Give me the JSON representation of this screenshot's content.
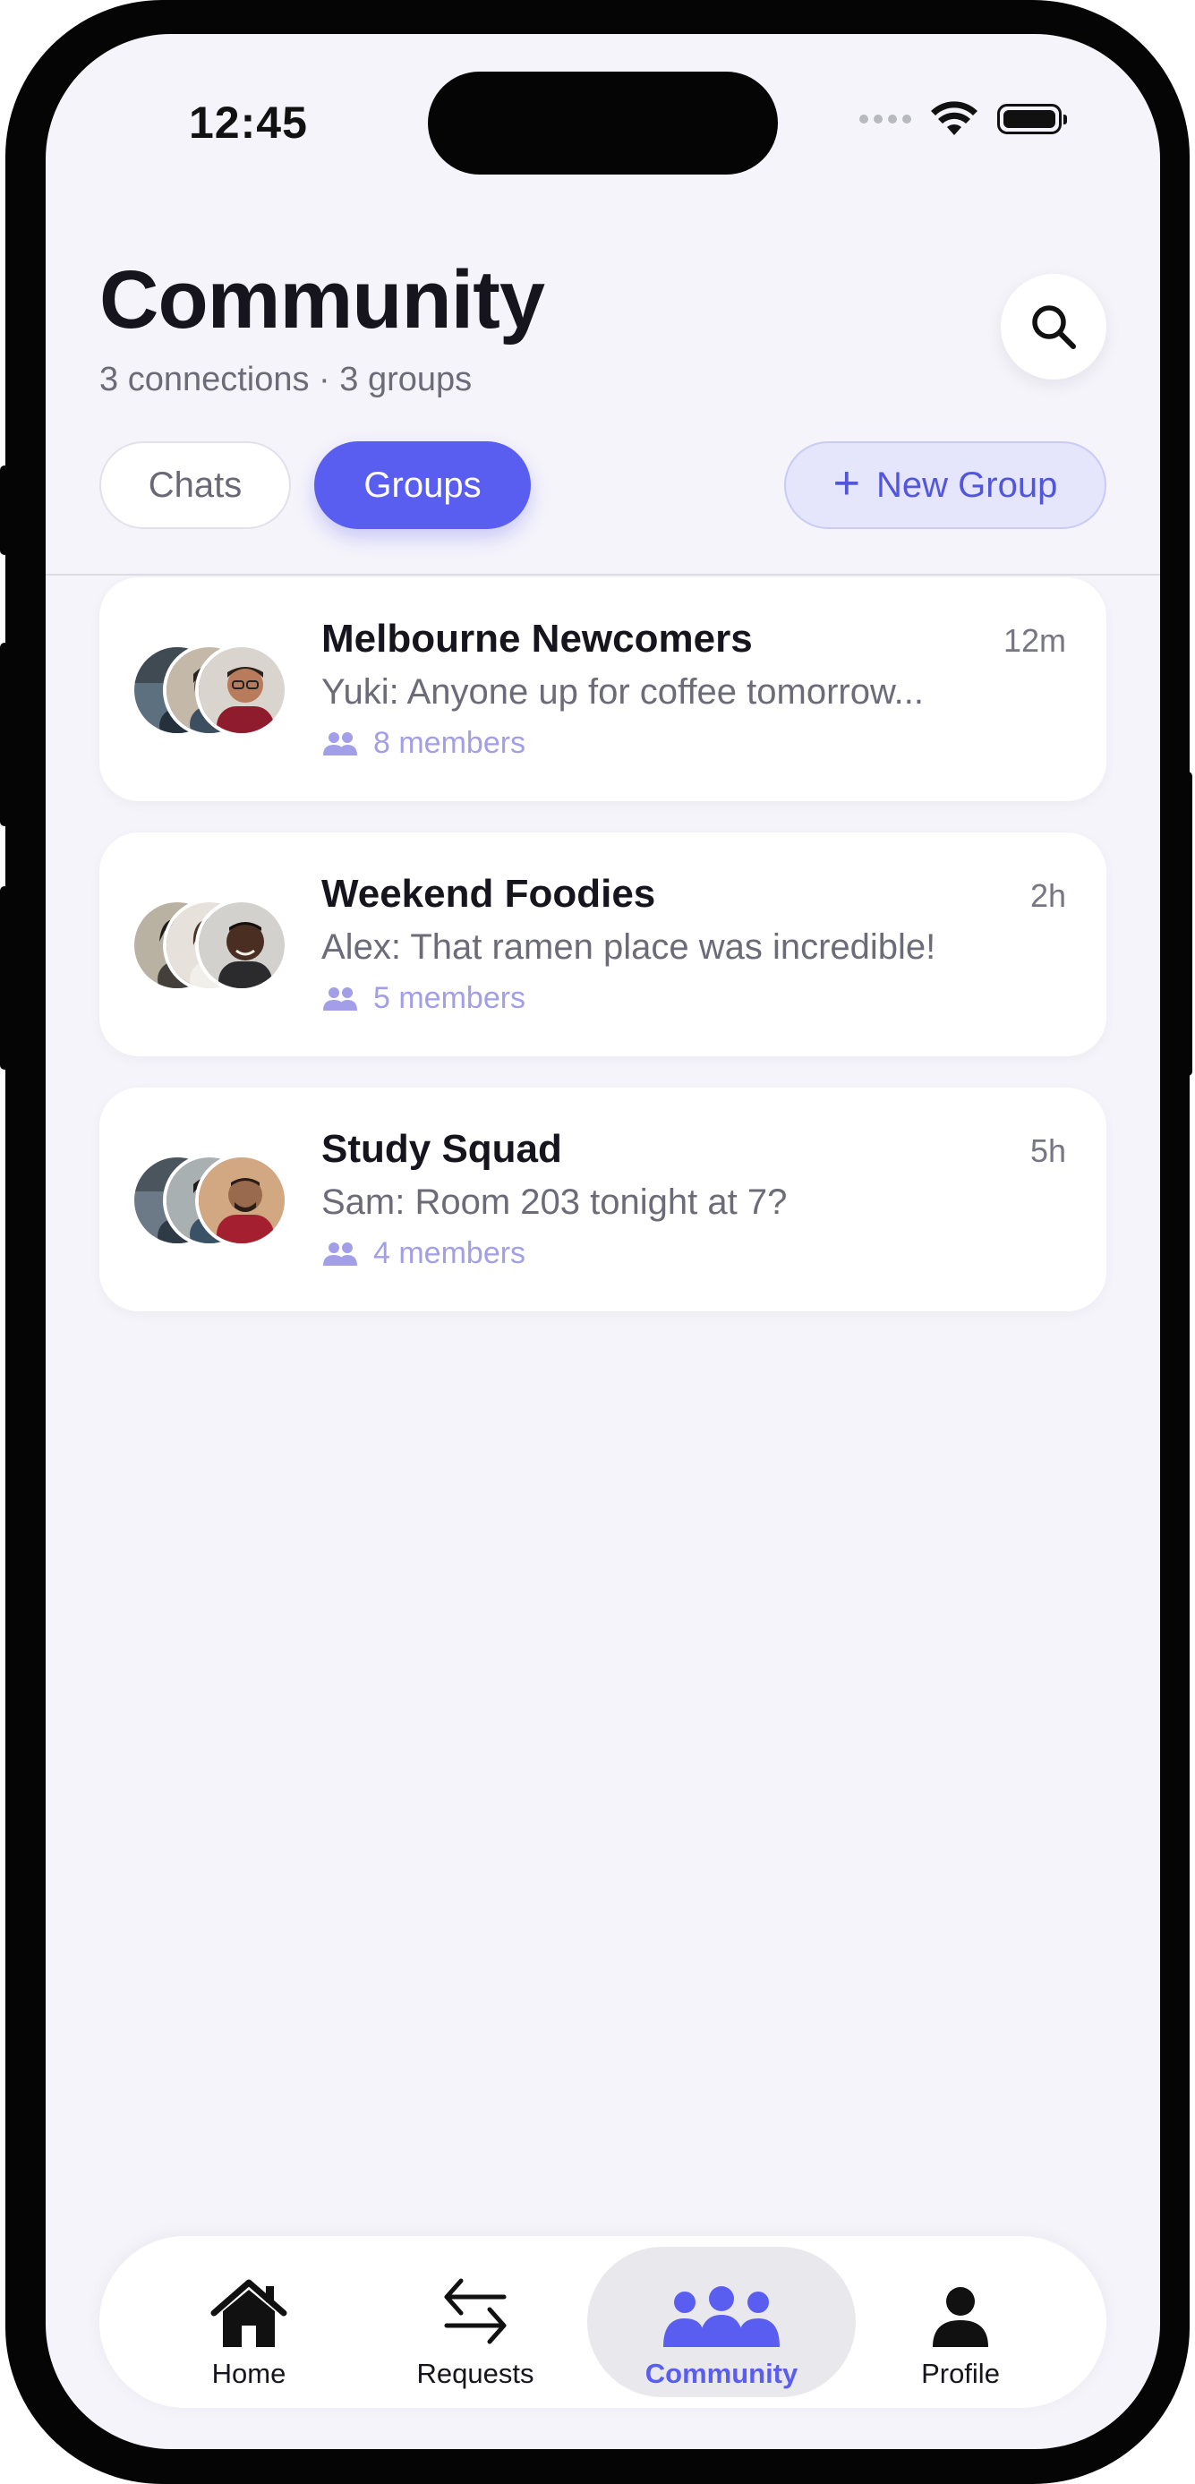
{
  "status_bar": {
    "time": "12:45"
  },
  "header": {
    "title": "Community",
    "subtitle": "3 connections · 3 groups"
  },
  "icons": {
    "search": "search-icon",
    "members": "people-icon",
    "home": "home-icon",
    "requests": "swap-arrows-icon",
    "community": "community-icon",
    "profile": "person-icon"
  },
  "tabs": [
    {
      "label": "Chats",
      "active": false
    },
    {
      "label": "Groups",
      "active": true
    }
  ],
  "new_group": {
    "label": "New Group"
  },
  "groups": [
    {
      "name": "Melbourne Newcomers",
      "time": "12m",
      "preview": "Yuki: Anyone up for coffee tomorrow...",
      "members": "8 members"
    },
    {
      "name": "Weekend Foodies",
      "time": "2h",
      "preview": "Alex: That ramen place was incredible!",
      "members": "5 members"
    },
    {
      "name": "Study Squad",
      "time": "5h",
      "preview": "Sam: Room 203 tonight at 7?",
      "members": "4 members"
    }
  ],
  "tabbar": {
    "items": [
      {
        "label": "Home",
        "active": false
      },
      {
        "label": "Requests",
        "active": false
      },
      {
        "label": "Community",
        "active": true
      },
      {
        "label": "Profile",
        "active": false
      }
    ]
  },
  "colors": {
    "accent": "#5a5ef0",
    "accent_soft": "#e5e5fc",
    "members_text": "#a29ee8",
    "background": "#f5f4fa"
  }
}
